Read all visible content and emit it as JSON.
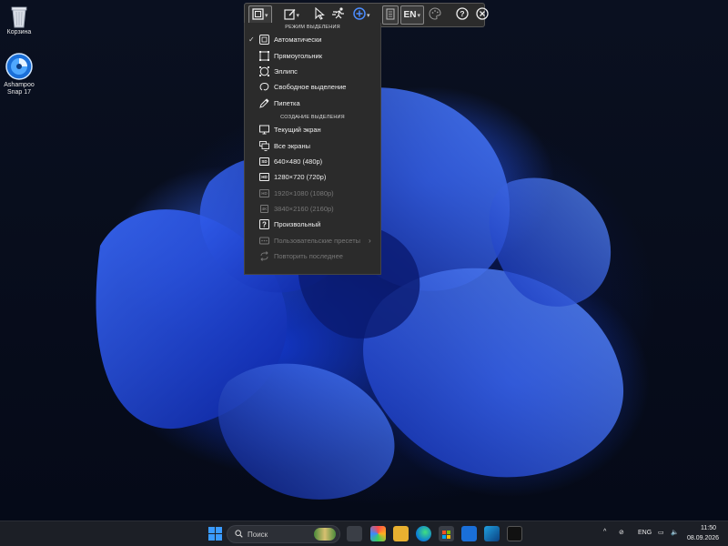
{
  "desktop": {
    "icons": [
      {
        "label": "Корзина"
      },
      {
        "label": "Ashampoo Snap 17"
      }
    ]
  },
  "toolbar": {
    "language": "EN"
  },
  "menu": {
    "section1": "РЕЖИМ ВЫДЕЛЕНИЯ",
    "mode_items": [
      {
        "label": "Автоматически",
        "checked": true
      },
      {
        "label": "Прямоугольник"
      },
      {
        "label": "Эллипс"
      },
      {
        "label": "Свободное выделение"
      },
      {
        "label": "Пипетка"
      }
    ],
    "section2": "СОЗДАНИЕ ВЫДЕЛЕНИЯ",
    "create_items": [
      {
        "label": "Текущий экран"
      },
      {
        "label": "Все экраны"
      },
      {
        "label": "640×480 (480p)",
        "badge": "SD"
      },
      {
        "label": "1280×720 (720p)",
        "badge": "HD"
      },
      {
        "label": "1920×1080 (1080p)",
        "badge": "HD",
        "disabled": true
      },
      {
        "label": "3840×2160 (2160p)",
        "badge": "4K",
        "disabled": true
      },
      {
        "label": "Произвольный"
      },
      {
        "label": "Пользовательские пресеты",
        "disabled": true
      },
      {
        "label": "Повторить последнее",
        "disabled": true
      }
    ]
  },
  "taskbar": {
    "search_placeholder": "Поиск",
    "language": "ENG",
    "time": "11:50",
    "date": "08.09.2026"
  }
}
